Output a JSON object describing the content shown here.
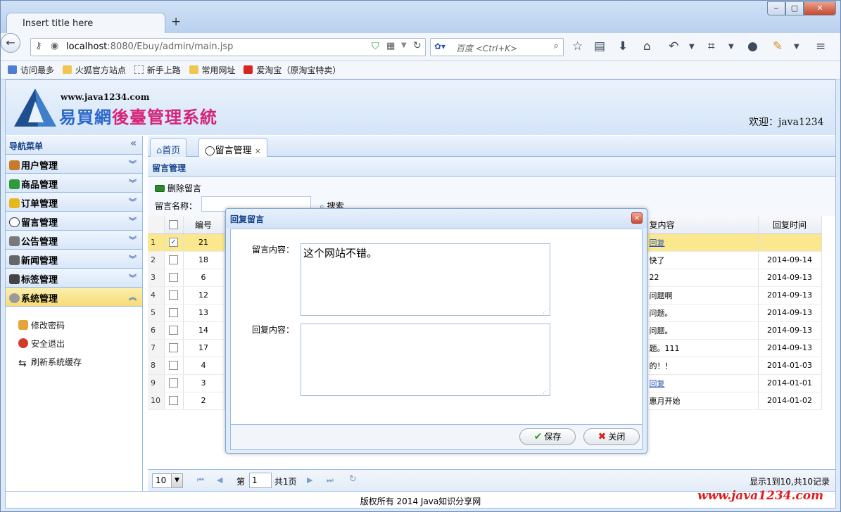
{
  "browser": {
    "tab_title": "Insert title here",
    "new_tab": "+",
    "url_host": "localhost",
    "url_path": ":8080/Ebuy/admin/main.jsp",
    "search_placeholder": "百度 <Ctrl+K>",
    "window_min": "‒",
    "window_max": "▢",
    "window_close": "✕"
  },
  "bookmarks": [
    "访问最多",
    "火狐官方站点",
    "新手上路",
    "常用网址",
    "爱淘宝（原淘宝特卖）"
  ],
  "header": {
    "site_url": "www.java1234.com",
    "title_part1": "易買網",
    "title_part2": "後臺管理系統",
    "welcome": "欢迎：java1234"
  },
  "sidebar": {
    "title": "导航菜单",
    "collapse": "«",
    "items": [
      {
        "label": "用户管理",
        "color": "#c77a2a"
      },
      {
        "label": "商品管理",
        "color": "#2f9a3a"
      },
      {
        "label": "订单管理",
        "color": "#e6b81e"
      },
      {
        "label": "留言管理",
        "color": "#ffffff"
      },
      {
        "label": "公告管理",
        "color": "#7a7a7a"
      },
      {
        "label": "新闻管理",
        "color": "#666666"
      },
      {
        "label": "标签管理",
        "color": "#444444"
      },
      {
        "label": "系统管理",
        "color": "#9a9a9a"
      }
    ],
    "sub_items": [
      {
        "label": "修改密码",
        "color": "#e5a43a"
      },
      {
        "label": "安全退出",
        "color": "#d23a2a"
      },
      {
        "label": "刷新系统缓存",
        "color": "#222222"
      }
    ]
  },
  "tabs": [
    {
      "label": "首页"
    },
    {
      "label": "留言管理",
      "close": "×"
    }
  ],
  "panel": {
    "title": "留言管理",
    "delete_button": "删除留言",
    "name_label": "留言名称：",
    "search_button": "搜索"
  },
  "grid": {
    "col_id": "编号",
    "col_reply": "回复内容",
    "col_reply_visible": "复内容",
    "col_time": "回复时间",
    "rows": [
      {
        "rn": "1",
        "id": "21",
        "reply": "回复",
        "time": "",
        "checked": "✓"
      },
      {
        "rn": "2",
        "id": "18",
        "reply": "快了",
        "time": "2014-09-14",
        "checked": ""
      },
      {
        "rn": "3",
        "id": "6",
        "reply": "22",
        "time": "2014-09-13",
        "checked": ""
      },
      {
        "rn": "4",
        "id": "12",
        "reply": "问题啊",
        "time": "2014-09-13",
        "checked": ""
      },
      {
        "rn": "5",
        "id": "13",
        "reply": "问题。",
        "time": "2014-09-13",
        "checked": ""
      },
      {
        "rn": "6",
        "id": "14",
        "reply": "问题。",
        "time": "2014-09-13",
        "checked": ""
      },
      {
        "rn": "7",
        "id": "17",
        "reply": "题。111",
        "time": "2014-09-13",
        "checked": ""
      },
      {
        "rn": "8",
        "id": "4",
        "reply": "的！！",
        "time": "2014-01-03",
        "checked": ""
      },
      {
        "rn": "9",
        "id": "3",
        "reply": "回复",
        "time": "2014-01-01",
        "checked": ""
      },
      {
        "rn": "10",
        "id": "2",
        "reply": "惠月开始",
        "time": "2014-01-02",
        "checked": ""
      }
    ]
  },
  "pager": {
    "page_size": "10",
    "page_prefix": "第",
    "page_value": "1",
    "page_suffix": "共1页",
    "info": "显示1到10,共10记录"
  },
  "dialog": {
    "title": "回复留言",
    "close": "×",
    "content_label": "留言内容：",
    "content_value": "这个网站不错。",
    "reply_label": "回复内容：",
    "reply_value": "",
    "save_button": "保存",
    "close_button": "关闭"
  },
  "footer": {
    "copyright": "版权所有 2014 Java知识分享网",
    "watermark": "www.java1234.com"
  }
}
